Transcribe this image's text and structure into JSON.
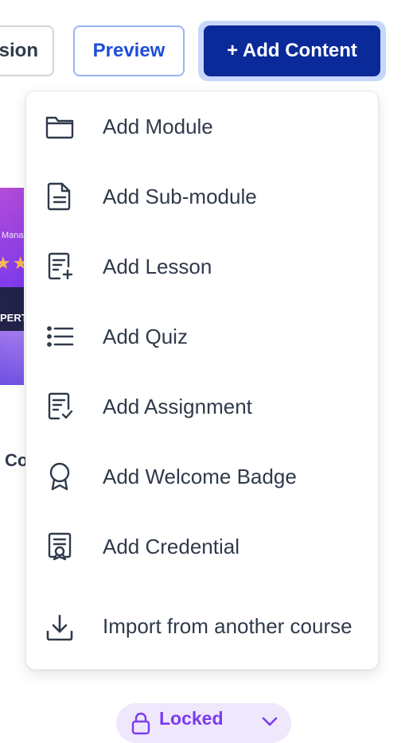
{
  "toolbar": {
    "version_label": "Version",
    "preview_label": "Preview",
    "add_content_label": "+ Add Content"
  },
  "menu": {
    "items": [
      {
        "label": "Add Module",
        "icon": "folder-icon"
      },
      {
        "label": "Add Sub-module",
        "icon": "document-icon"
      },
      {
        "label": "Add Lesson",
        "icon": "lesson-add-icon"
      },
      {
        "label": "Add Quiz",
        "icon": "list-icon"
      },
      {
        "label": "Add Assignment",
        "icon": "assignment-check-icon"
      },
      {
        "label": "Add Welcome Badge",
        "icon": "badge-icon"
      },
      {
        "label": "Add Credential",
        "icon": "credential-icon"
      },
      {
        "label": "Import from another course",
        "icon": "download-icon"
      }
    ]
  },
  "background": {
    "card_text_manage": "Manag",
    "card_text_expert": "PERT",
    "partial_text": "Co",
    "locked_label": "Locked"
  },
  "colors": {
    "primary": "#0a2a99",
    "primary_ring": "#c7d7fb",
    "preview_text": "#1d4ed8",
    "text": "#2f3a4a",
    "locked_bg": "#efe8fd",
    "locked_text": "#7c3aed"
  }
}
